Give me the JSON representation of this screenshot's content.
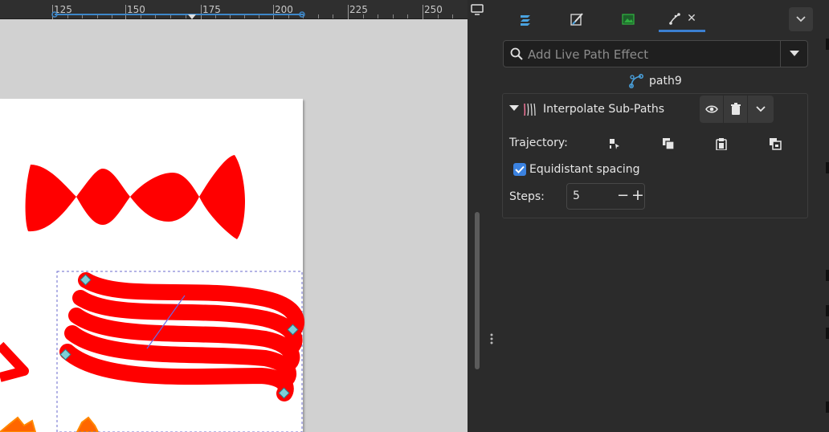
{
  "ruler": {
    "labels": [
      "125",
      "150",
      "175",
      "200",
      "225",
      "250"
    ]
  },
  "colors": {
    "accent": "#3b7fd1",
    "shape_fill": "#ff0000",
    "node": "#7fcfd8",
    "path_line": "#6a6ae8"
  },
  "canvas": {
    "display_button_icon": "monitor-icon"
  },
  "panel": {
    "tabs": [
      {
        "name": "layers-tab",
        "icon": "layers-icon"
      },
      {
        "name": "fill-stroke-tab",
        "icon": "fill-stroke-icon"
      },
      {
        "name": "export-tab",
        "icon": "image-icon"
      },
      {
        "name": "path-effects-tab",
        "icon": "path-effects-icon",
        "active": true,
        "close": "✕"
      }
    ],
    "search": {
      "placeholder": "Add Live Path Effect",
      "value": ""
    },
    "item_name": "path9",
    "effect": {
      "title": "Interpolate Sub-Paths",
      "trajectory_label": "Trajectory:",
      "trajectory_buttons": [
        "edit-on-canvas-icon",
        "copy-path-icon",
        "paste-path-icon",
        "link-to-path-icon"
      ],
      "equidistant_label": "Equidistant spacing",
      "equidistant_checked": true,
      "steps_label": "Steps:",
      "steps_value": "5",
      "steps_minus": "−",
      "steps_plus": "+"
    }
  }
}
